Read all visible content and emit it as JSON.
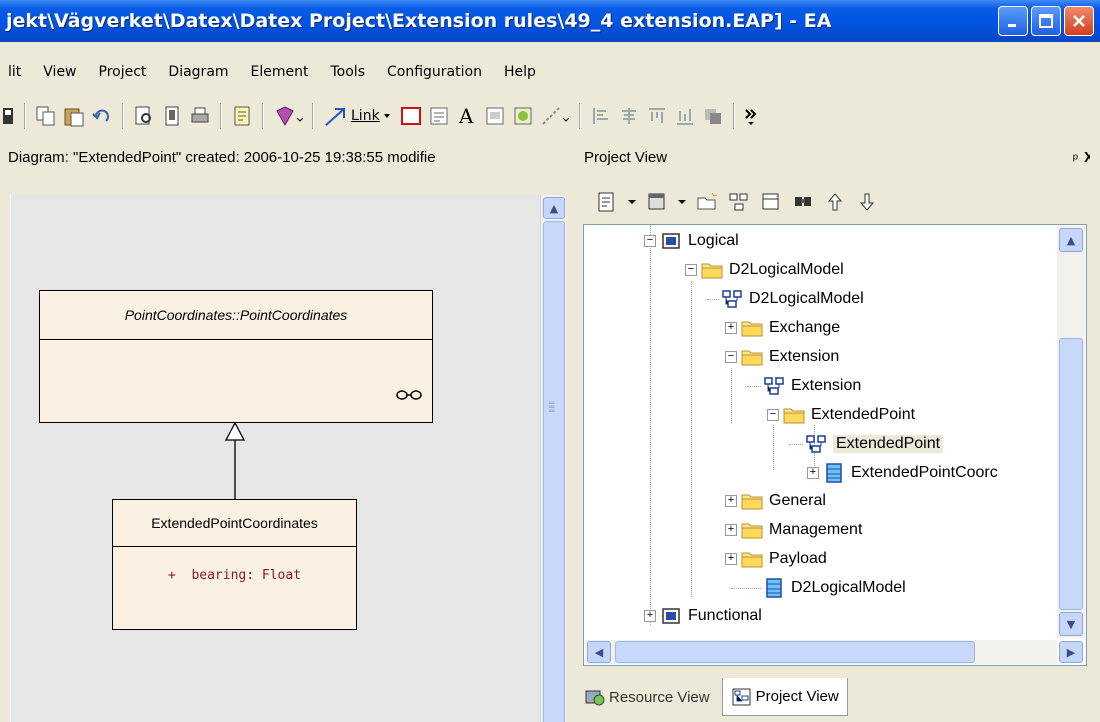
{
  "window": {
    "title": "jekt\\Vägverket\\Datex\\Datex Project\\Extension rules\\49_4 extension.EAP] - EA"
  },
  "menu": [
    "lit",
    "View",
    "Project",
    "Diagram",
    "Element",
    "Tools",
    "Configuration",
    "Help"
  ],
  "toolbar": {
    "link_label": "Link"
  },
  "diagram": {
    "info": "Diagram: \"ExtendedPoint\"   created: 2006-10-25 19:38:55  modifie",
    "classes": {
      "base": {
        "name": "PointCoordinates::PointCoordinates"
      },
      "derived": {
        "name": "ExtendedPointCoordinates",
        "attr_vis": "+",
        "attr_text": "bearing: Float"
      }
    }
  },
  "project_view": {
    "title": "Project View",
    "pin": "ઈ",
    "close": "X",
    "tree": [
      {
        "label": "Logical",
        "icon": "package-icon",
        "expander": "−"
      },
      {
        "label": "D2LogicalModel",
        "icon": "folder-icon",
        "expander": "−"
      },
      {
        "label": "D2LogicalModel",
        "icon": "diagram-icon",
        "expander": ""
      },
      {
        "label": "Exchange",
        "icon": "folder-icon",
        "expander": "+"
      },
      {
        "label": "Extension",
        "icon": "folder-icon",
        "expander": "−"
      },
      {
        "label": "Extension",
        "icon": "diagram-icon",
        "expander": ""
      },
      {
        "label": "ExtendedPoint",
        "icon": "folder-icon",
        "expander": "−"
      },
      {
        "label": "ExtendedPoint",
        "icon": "diagram-icon",
        "expander": ""
      },
      {
        "label": "ExtendedPointCoorc",
        "icon": "class-icon",
        "expander": "+"
      },
      {
        "label": "General",
        "icon": "folder-icon",
        "expander": "+"
      },
      {
        "label": "Management",
        "icon": "folder-icon",
        "expander": "+"
      },
      {
        "label": "Payload",
        "icon": "folder-icon",
        "expander": "+"
      },
      {
        "label": "D2LogicalModel",
        "icon": "class-icon",
        "expander": ""
      },
      {
        "label": "Functional",
        "icon": "package-icon",
        "expander": "+"
      }
    ],
    "tabs": [
      "Resource View",
      "Project View"
    ]
  }
}
